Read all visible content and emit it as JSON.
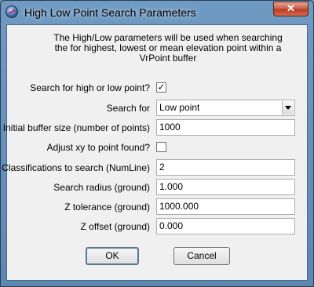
{
  "window": {
    "title": "High Low Point Search Parameters",
    "close_label": "✕"
  },
  "description": "The High/Low parameters will be used when searching the for highest, lowest or mean elevation point within a VrPoint buffer",
  "fields": {
    "search_high_low": {
      "label": "Search for high or low point?",
      "checked": true,
      "mark": "✓"
    },
    "search_for": {
      "label": "Search for",
      "value": "Low point"
    },
    "initial_buffer": {
      "label": "Initial buffer size (number of points)",
      "value": "1000"
    },
    "adjust_xy": {
      "label": "Adjust xy to point found?",
      "checked": false,
      "mark": ""
    },
    "classifications": {
      "label": "Classifications to search (NumLine)",
      "value": "2"
    },
    "search_radius": {
      "label": "Search radius (ground)",
      "value": "1.000"
    },
    "z_tolerance": {
      "label": "Z tolerance (ground)",
      "value": "1000.000"
    },
    "z_offset": {
      "label": "Z offset (ground)",
      "value": "0.000"
    }
  },
  "buttons": {
    "ok": "OK",
    "cancel": "Cancel"
  },
  "colors": {
    "title_bar": "#6b8fb3",
    "client_bg": "#f0f0f0",
    "close_button": "#c75b45"
  }
}
